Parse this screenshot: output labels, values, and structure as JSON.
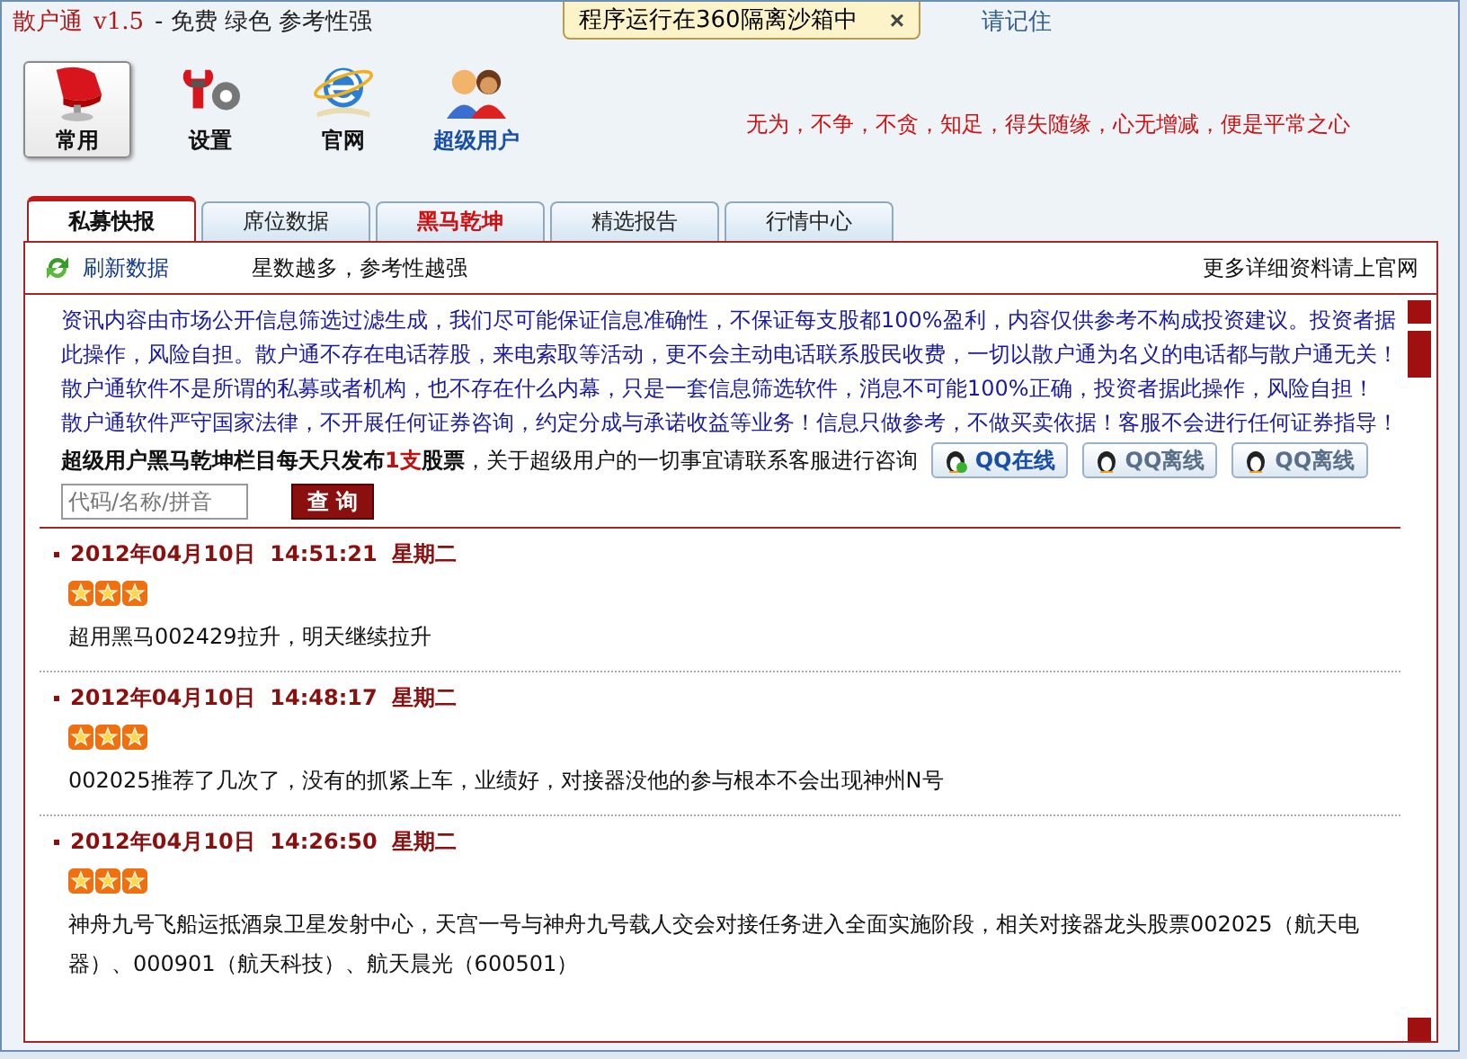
{
  "title_bar": {
    "app_name": "散户通",
    "version": "v1.5",
    "tagline": "- 免费  绿色  参考性强",
    "right_text": "请记住"
  },
  "sandbox_notice": {
    "text": "程序运行在360隔离沙箱中",
    "close": "×"
  },
  "toolbar": {
    "buttons": [
      {
        "label": "常用",
        "kind": "common",
        "selected": true
      },
      {
        "label": "设置",
        "kind": "settings",
        "selected": false
      },
      {
        "label": "官网",
        "kind": "website",
        "selected": false
      },
      {
        "label": "超级用户",
        "kind": "users",
        "selected": false
      }
    ],
    "motto": "无为，不争，不贪，知足，得失随缘，心无增减，便是平常之心"
  },
  "tabs": [
    {
      "label": "私募快报",
      "selected": true,
      "highlight": false
    },
    {
      "label": "席位数据",
      "selected": false,
      "highlight": false
    },
    {
      "label": "黑马乾坤",
      "selected": false,
      "highlight": true
    },
    {
      "label": "精选报告",
      "selected": false,
      "highlight": false
    },
    {
      "label": "行情中心",
      "selected": false,
      "highlight": false
    }
  ],
  "panel_bar": {
    "refresh": "刷新数据",
    "hint": "星数越多，参考性越强",
    "link": "更多详细资料请上官网"
  },
  "notice": {
    "paragraphs": [
      "资讯内容由市场公开信息筛选过滤生成，我们尽可能保证信息准确性，不保证每支股都100%盈利，内容仅供参考不构成投资建议。投资者据此操作，风险自担。散户通不存在电话荐股，来电索取等活动，更不会主动电话联系股民收费，一切以散户通为名义的电话都与散户通无关！",
      "散户通软件不是所谓的私募或者机构，也不存在什么内幕，只是一套信息筛选软件，消息不可能100%正确，投资者据此操作，风险自担！",
      "散户通软件严守国家法律，不开展任何证券咨询，约定分成与承诺收益等业务！信息只做参考，不做买卖依据！客服不会进行任何证券指导！"
    ],
    "super_line": [
      {
        "kind": "bold",
        "text": "超级用户黑马乾坤栏目每天只发布"
      },
      {
        "kind": "accent",
        "text": "1支"
      },
      {
        "kind": "bold",
        "text": "股票"
      },
      {
        "kind": "plain",
        "text": "，关于超级用户的一切事宜请联系客服进行咨询"
      }
    ],
    "qq_buttons": [
      {
        "label": "QQ在线",
        "online": true
      },
      {
        "label": "QQ离线",
        "online": false
      },
      {
        "label": "QQ离线",
        "online": false
      }
    ],
    "search": {
      "placeholder": "代码/名称/拼音",
      "button": "查 询"
    }
  },
  "news": [
    {
      "date": "2012年04月10日  14:51:21  星期二",
      "stars": 3,
      "text": "超用黑马002429拉升，明天继续拉升"
    },
    {
      "date": "2012年04月10日  14:48:17  星期二",
      "stars": 3,
      "text": "002025推荐了几次了，没有的抓紧上车，业绩好，对接器没他的参与根本不会出现神州N号"
    },
    {
      "date": "2012年04月10日  14:26:50  星期二",
      "stars": 3,
      "text": "神舟九号飞船运抵酒泉卫星发射中心，天宫一号与神舟九号载人交会对接任务进入全面实施阶段，相关对接器龙头股票002025（航天电器）、000901（航天科技）、航天晨光（600501）"
    }
  ]
}
